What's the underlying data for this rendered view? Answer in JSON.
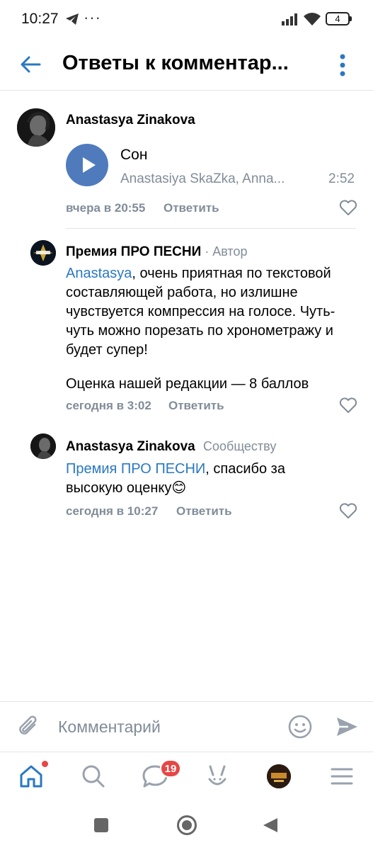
{
  "status_bar": {
    "time": "10:27",
    "dots": "···",
    "battery": "4"
  },
  "header": {
    "title": "Ответы к комментар..."
  },
  "comments": [
    {
      "author": "Anastasya Zinakova",
      "audio": {
        "title": "Сон",
        "artist": "Anastasiya SkaZka, Anna...",
        "duration": "2:52"
      },
      "time": "вчера в 20:55",
      "reply_label": "Ответить"
    },
    {
      "author": "Премия ПРО ПЕСНИ",
      "author_role": " · Автор",
      "mention": "Anastasya",
      "text": ", очень приятная по текстовой составляющей работа, но излишне чувствуется компрессия на голосе. Чуть-чуть можно порезать по хронометражу и будет супер!",
      "text2": "Оценка нашей редакции — 8 баллов",
      "time": "сегодня в 3:02",
      "reply_label": "Ответить"
    },
    {
      "author": "Anastasya Zinakova",
      "author_role": "Сообществу",
      "mention": "Премия ПРО ПЕСНИ",
      "text": ", спасибо за высокую оценку",
      "emoji": "😊",
      "time": "сегодня в 10:27",
      "reply_label": "Ответить"
    }
  ],
  "composer": {
    "placeholder": "Комментарий"
  },
  "bottom_nav": {
    "messages_badge": "19",
    "items": [
      "home-icon",
      "search-icon",
      "messages-icon",
      "services-icon",
      "profile-avatar",
      "menu-icon"
    ]
  },
  "colors": {
    "accent": "#2a78c2",
    "play_button": "#4f7bbd",
    "secondary_text": "#818c99",
    "badge": "#e64646"
  }
}
